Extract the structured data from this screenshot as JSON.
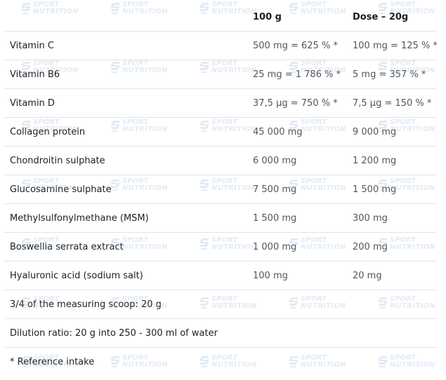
{
  "table": {
    "header": {
      "name": "",
      "per100": "100 g",
      "dose": "Dose – 20g"
    },
    "rows": [
      {
        "name": "Vitamin C",
        "per100": "500 mg = 625 % *",
        "dose": "100 mg = 125 % *"
      },
      {
        "name": "Vitamin B6",
        "per100": "25 mg = 1 786 % *",
        "dose": "5 mg = 357 % *"
      },
      {
        "name": "Vitamin D",
        "per100": "37,5 µg = 750 % *",
        "dose": "7,5 µg = 150 % *"
      },
      {
        "name": "Collagen protein",
        "per100": "45 000 mg",
        "dose": "9 000 mg"
      },
      {
        "name": "Chondroitin sulphate",
        "per100": "6 000 mg",
        "dose": "1 200 mg"
      },
      {
        "name": "Glucosamine sulphate",
        "per100": "7 500 mg",
        "dose": "1 500 mg"
      },
      {
        "name": "Methylsulfonylmethane (MSM)",
        "per100": "1 500 mg",
        "dose": "300 mg"
      },
      {
        "name": "Boswellia serrata extract",
        "per100": "1 000 mg",
        "dose": "200 mg"
      },
      {
        "name": "Hyaluronic acid (sodium salt)",
        "per100": "100 mg",
        "dose": "20 mg"
      }
    ],
    "notes": {
      "serving": "3/4 of the measuring scoop: 20 g",
      "dilution": "Dilution ratio: 20 g into 250 - 300 ml of water",
      "reference": "* Reference intake"
    }
  },
  "watermark": {
    "line1": "SPORT",
    "line2": "NUTRITION",
    "color": "#7ea6d6"
  }
}
